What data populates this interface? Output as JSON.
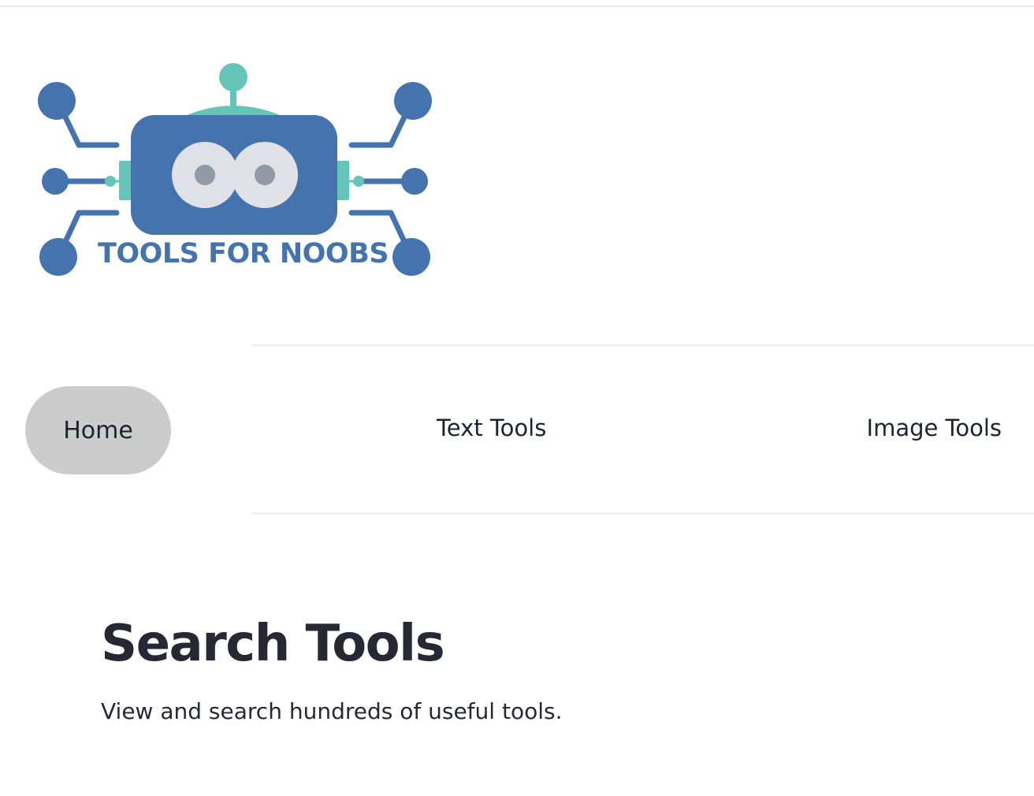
{
  "brand": {
    "logo_text": "TOOLS FOR NOOBS",
    "logo_icon": "robot-circuit-logo",
    "colors": {
      "primary_blue": "#4573ad",
      "accent_teal": "#64c4b8",
      "eye_white": "#dfe1e6",
      "pupil_gray": "#9099a5"
    }
  },
  "nav": {
    "items": [
      {
        "label": "Home",
        "active": true
      },
      {
        "label": "Text Tools",
        "active": false
      },
      {
        "label": "Image Tools",
        "active": false
      }
    ],
    "active_color": "#cccccc"
  },
  "main": {
    "title": "Search Tools",
    "subtitle": "View and search hundreds of useful tools."
  }
}
